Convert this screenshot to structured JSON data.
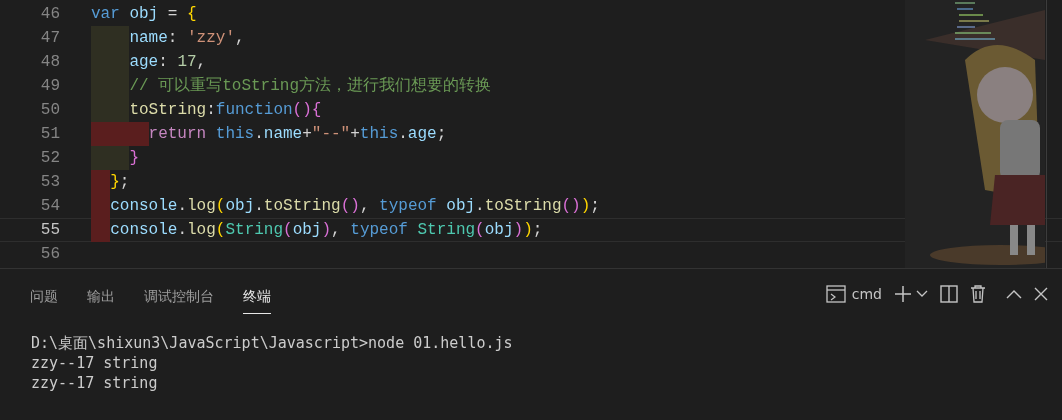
{
  "editor": {
    "lines": [
      {
        "number": "46",
        "current": false,
        "tokens": [
          {
            "text": "var",
            "kind": "keyword"
          },
          {
            "text": " obj",
            "kind": "variable"
          },
          {
            "text": " = ",
            "kind": "plain"
          },
          {
            "text": "{",
            "kind": "bracket1"
          }
        ]
      },
      {
        "number": "47",
        "current": false,
        "indent": [
          {
            "kind": "guide"
          },
          {
            "kind": "guide"
          }
        ],
        "tokens": [
          {
            "text": "name",
            "kind": "variable"
          },
          {
            "text": ": ",
            "kind": "plain"
          },
          {
            "text": "'zzy'",
            "kind": "string"
          },
          {
            "text": ",",
            "kind": "plain"
          }
        ]
      },
      {
        "number": "48",
        "current": false,
        "indent": [
          {
            "kind": "guide"
          },
          {
            "kind": "guide"
          }
        ],
        "tokens": [
          {
            "text": "age",
            "kind": "variable"
          },
          {
            "text": ": ",
            "kind": "plain"
          },
          {
            "text": "17",
            "kind": "number"
          },
          {
            "text": ",",
            "kind": "plain"
          }
        ]
      },
      {
        "number": "49",
        "current": false,
        "indent": [
          {
            "kind": "guide"
          },
          {
            "kind": "guide"
          }
        ],
        "tokens": [
          {
            "text": "// 可以重写toString方法，进行我们想要的转换",
            "kind": "comment"
          }
        ]
      },
      {
        "number": "50",
        "current": false,
        "indent": [
          {
            "kind": "guide"
          },
          {
            "kind": "guide"
          }
        ],
        "tokens": [
          {
            "text": "toString",
            "kind": "function"
          },
          {
            "text": ":",
            "kind": "plain"
          },
          {
            "text": "function",
            "kind": "keyword"
          },
          {
            "text": "()",
            "kind": "bracket2"
          },
          {
            "text": "{",
            "kind": "bracket2"
          }
        ]
      },
      {
        "number": "51",
        "current": false,
        "indent": [
          {
            "kind": "error"
          },
          {
            "kind": "error"
          },
          {
            "kind": "error"
          }
        ],
        "tokens": [
          {
            "text": "return",
            "kind": "control"
          },
          {
            "text": " this",
            "kind": "keyword"
          },
          {
            "text": ".",
            "kind": "plain"
          },
          {
            "text": "name",
            "kind": "variable"
          },
          {
            "text": "+",
            "kind": "plain"
          },
          {
            "text": "\"--\"",
            "kind": "string"
          },
          {
            "text": "+",
            "kind": "plain"
          },
          {
            "text": "this",
            "kind": "keyword"
          },
          {
            "text": ".",
            "kind": "plain"
          },
          {
            "text": "age",
            "kind": "variable"
          },
          {
            "text": ";",
            "kind": "plain"
          }
        ]
      },
      {
        "number": "52",
        "current": false,
        "indent": [
          {
            "kind": "guide"
          },
          {
            "kind": "guide"
          }
        ],
        "tokens": [
          {
            "text": "}",
            "kind": "bracket2"
          }
        ]
      },
      {
        "number": "53",
        "current": false,
        "indent": [
          {
            "kind": "error"
          }
        ],
        "tokens": [
          {
            "text": "}",
            "kind": "bracket1"
          },
          {
            "text": ";",
            "kind": "plain"
          }
        ]
      },
      {
        "number": "54",
        "current": false,
        "indent": [
          {
            "kind": "error"
          }
        ],
        "tokens": [
          {
            "text": "console",
            "kind": "variable"
          },
          {
            "text": ".",
            "kind": "plain"
          },
          {
            "text": "log",
            "kind": "function"
          },
          {
            "text": "(",
            "kind": "bracket1"
          },
          {
            "text": "obj",
            "kind": "variable"
          },
          {
            "text": ".",
            "kind": "plain"
          },
          {
            "text": "toString",
            "kind": "function"
          },
          {
            "text": "()",
            "kind": "bracket2"
          },
          {
            "text": ", ",
            "kind": "plain"
          },
          {
            "text": "typeof",
            "kind": "keyword"
          },
          {
            "text": " obj",
            "kind": "variable"
          },
          {
            "text": ".",
            "kind": "plain"
          },
          {
            "text": "toString",
            "kind": "function"
          },
          {
            "text": "()",
            "kind": "bracket2"
          },
          {
            "text": ")",
            "kind": "bracket1"
          },
          {
            "text": ";",
            "kind": "plain"
          }
        ]
      },
      {
        "number": "55",
        "current": true,
        "indent": [
          {
            "kind": "error"
          }
        ],
        "tokens": [
          {
            "text": "console",
            "kind": "variable"
          },
          {
            "text": ".",
            "kind": "plain"
          },
          {
            "text": "log",
            "kind": "function"
          },
          {
            "text": "(",
            "kind": "bracket1"
          },
          {
            "text": "String",
            "kind": "type"
          },
          {
            "text": "(",
            "kind": "bracket2"
          },
          {
            "text": "obj",
            "kind": "variable"
          },
          {
            "text": ")",
            "kind": "bracket2"
          },
          {
            "text": ", ",
            "kind": "plain"
          },
          {
            "text": "typeof",
            "kind": "keyword"
          },
          {
            "text": " String",
            "kind": "type"
          },
          {
            "text": "(",
            "kind": "bracket2"
          },
          {
            "text": "obj",
            "kind": "variable"
          },
          {
            "text": ")",
            "kind": "bracket2"
          },
          {
            "text": ")",
            "kind": "bracket1"
          },
          {
            "text": ";",
            "kind": "plain"
          }
        ]
      },
      {
        "number": "56",
        "current": false
      }
    ]
  },
  "panel": {
    "tabs": [
      {
        "label": "问题",
        "selected": false
      },
      {
        "label": "输出",
        "selected": false
      },
      {
        "label": "调试控制台",
        "selected": false
      },
      {
        "label": "终端",
        "selected": true
      }
    ],
    "terminal_name": "cmd",
    "terminal_lines": [
      "D:\\桌面\\shixun3\\JavaScript\\Javascript>node 01.hello.js",
      "zzy--17 string",
      "zzy--17 string"
    ]
  }
}
